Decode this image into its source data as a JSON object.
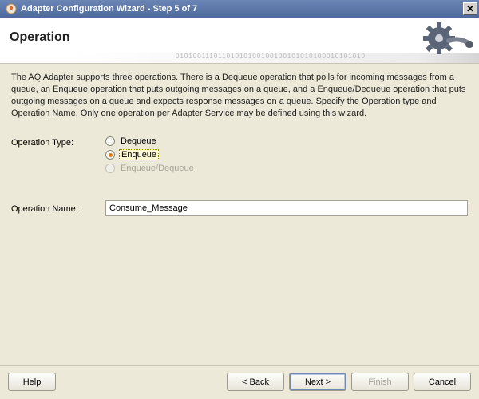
{
  "window": {
    "title": "Adapter Configuration Wizard - Step 5 of 7",
    "close_glyph": "✕"
  },
  "header": {
    "title": "Operation",
    "binary_deco": "01010011101101010100100100101010100010101010"
  },
  "description": "The AQ Adapter supports three operations.  There is a Dequeue operation that polls for incoming messages from a queue, an Enqueue operation that puts outgoing messages on a queue, and a Enqueue/Dequeue operation that puts outgoing messages on a queue and expects response messages on a queue.  Specify the Operation type and Operation Name. Only one operation per Adapter Service may be defined using this wizard.",
  "labels": {
    "operation_type": "Operation Type:",
    "operation_name": "Operation Name:"
  },
  "options": {
    "dequeue": "Dequeue",
    "enqueue": "Enqueue",
    "enqueue_dequeue": "Enqueue/Dequeue"
  },
  "fields": {
    "operation_name_value": "Consume_Message"
  },
  "buttons": {
    "help": "Help",
    "back": "< Back",
    "next": "Next >",
    "finish": "Finish",
    "cancel": "Cancel"
  }
}
